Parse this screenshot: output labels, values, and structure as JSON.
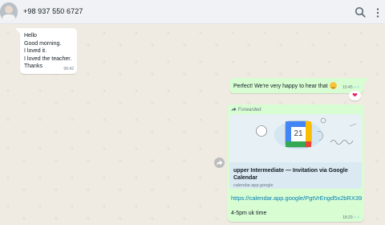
{
  "header": {
    "contact": "+98 937 550 6727"
  },
  "messages": {
    "incoming": {
      "lines": [
        "Hello",
        "Good morning.",
        "I loved it.",
        "I loved the teacher.",
        "Thanks"
      ],
      "time": "06:42"
    },
    "reply": {
      "text": "Perfect! We're very happy to hear that",
      "time": "15:45",
      "reaction": "❤"
    },
    "forwarded": {
      "label": "Forwarded",
      "preview_title": "upper Intermediate — Invitation via Google Calendar",
      "preview_domain": "calendar.app.google",
      "calendar_day": "21",
      "link": "https://calendar.app.google/PgtVrEngd5x2bRX39",
      "body": "4-5pm uk time",
      "time": "18:29"
    }
  }
}
